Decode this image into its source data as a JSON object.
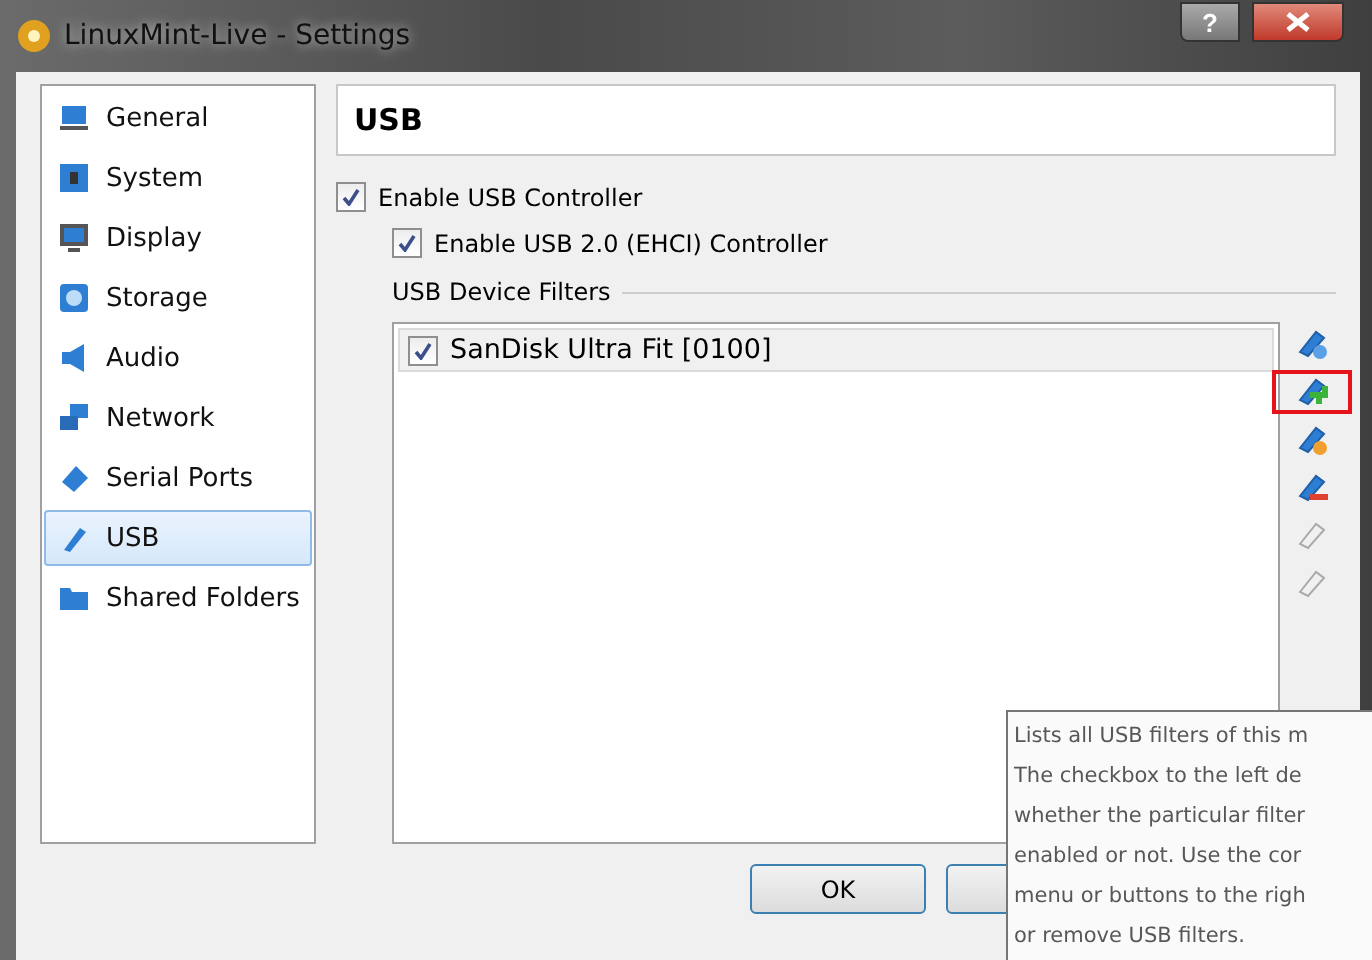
{
  "window": {
    "title": "LinuxMint-Live - Settings",
    "buttons": [
      {
        "kind": "help",
        "label": "?"
      },
      {
        "kind": "close"
      }
    ]
  },
  "sidebar": {
    "items": [
      {
        "label": "General",
        "kind": "general",
        "selected": false
      },
      {
        "label": "System",
        "kind": "system",
        "selected": false
      },
      {
        "label": "Display",
        "kind": "display",
        "selected": false
      },
      {
        "label": "Storage",
        "kind": "storage",
        "selected": false
      },
      {
        "label": "Audio",
        "kind": "audio",
        "selected": false
      },
      {
        "label": "Network",
        "kind": "network",
        "selected": false
      },
      {
        "label": "Serial Ports",
        "kind": "serial",
        "selected": false
      },
      {
        "label": "USB",
        "kind": "usb",
        "selected": true
      },
      {
        "label": "Shared Folders",
        "kind": "folder",
        "selected": false
      }
    ]
  },
  "page": {
    "title": "USB",
    "options": [
      {
        "label": "Enable USB Controller",
        "checked": true,
        "indented": false
      },
      {
        "label": "Enable USB 2.0 (EHCI) Controller",
        "checked": true,
        "indented": true
      }
    ],
    "filters_label": "USB Device Filters",
    "filters": [
      {
        "label": "SanDisk Ultra Fit [0100]",
        "checked": true,
        "selected": true
      }
    ],
    "tools": [
      {
        "kind": "add-empty",
        "disabled": false,
        "highlighted": false
      },
      {
        "kind": "add",
        "disabled": false,
        "highlighted": true
      },
      {
        "kind": "edit",
        "disabled": false,
        "highlighted": false
      },
      {
        "kind": "remove",
        "disabled": false,
        "highlighted": false
      },
      {
        "kind": "up",
        "disabled": true,
        "highlighted": false
      },
      {
        "kind": "down",
        "disabled": true,
        "highlighted": false
      }
    ]
  },
  "buttons": [
    {
      "kind": "labeled",
      "label": "OK"
    },
    {
      "kind": "covered"
    }
  ],
  "tooltip": {
    "lines": [
      "Lists all USB filters of this m",
      "The checkbox to the left de",
      "whether the particular filter",
      "enabled or not. Use the cor",
      "menu or buttons to the righ",
      "or remove USB filters."
    ]
  }
}
